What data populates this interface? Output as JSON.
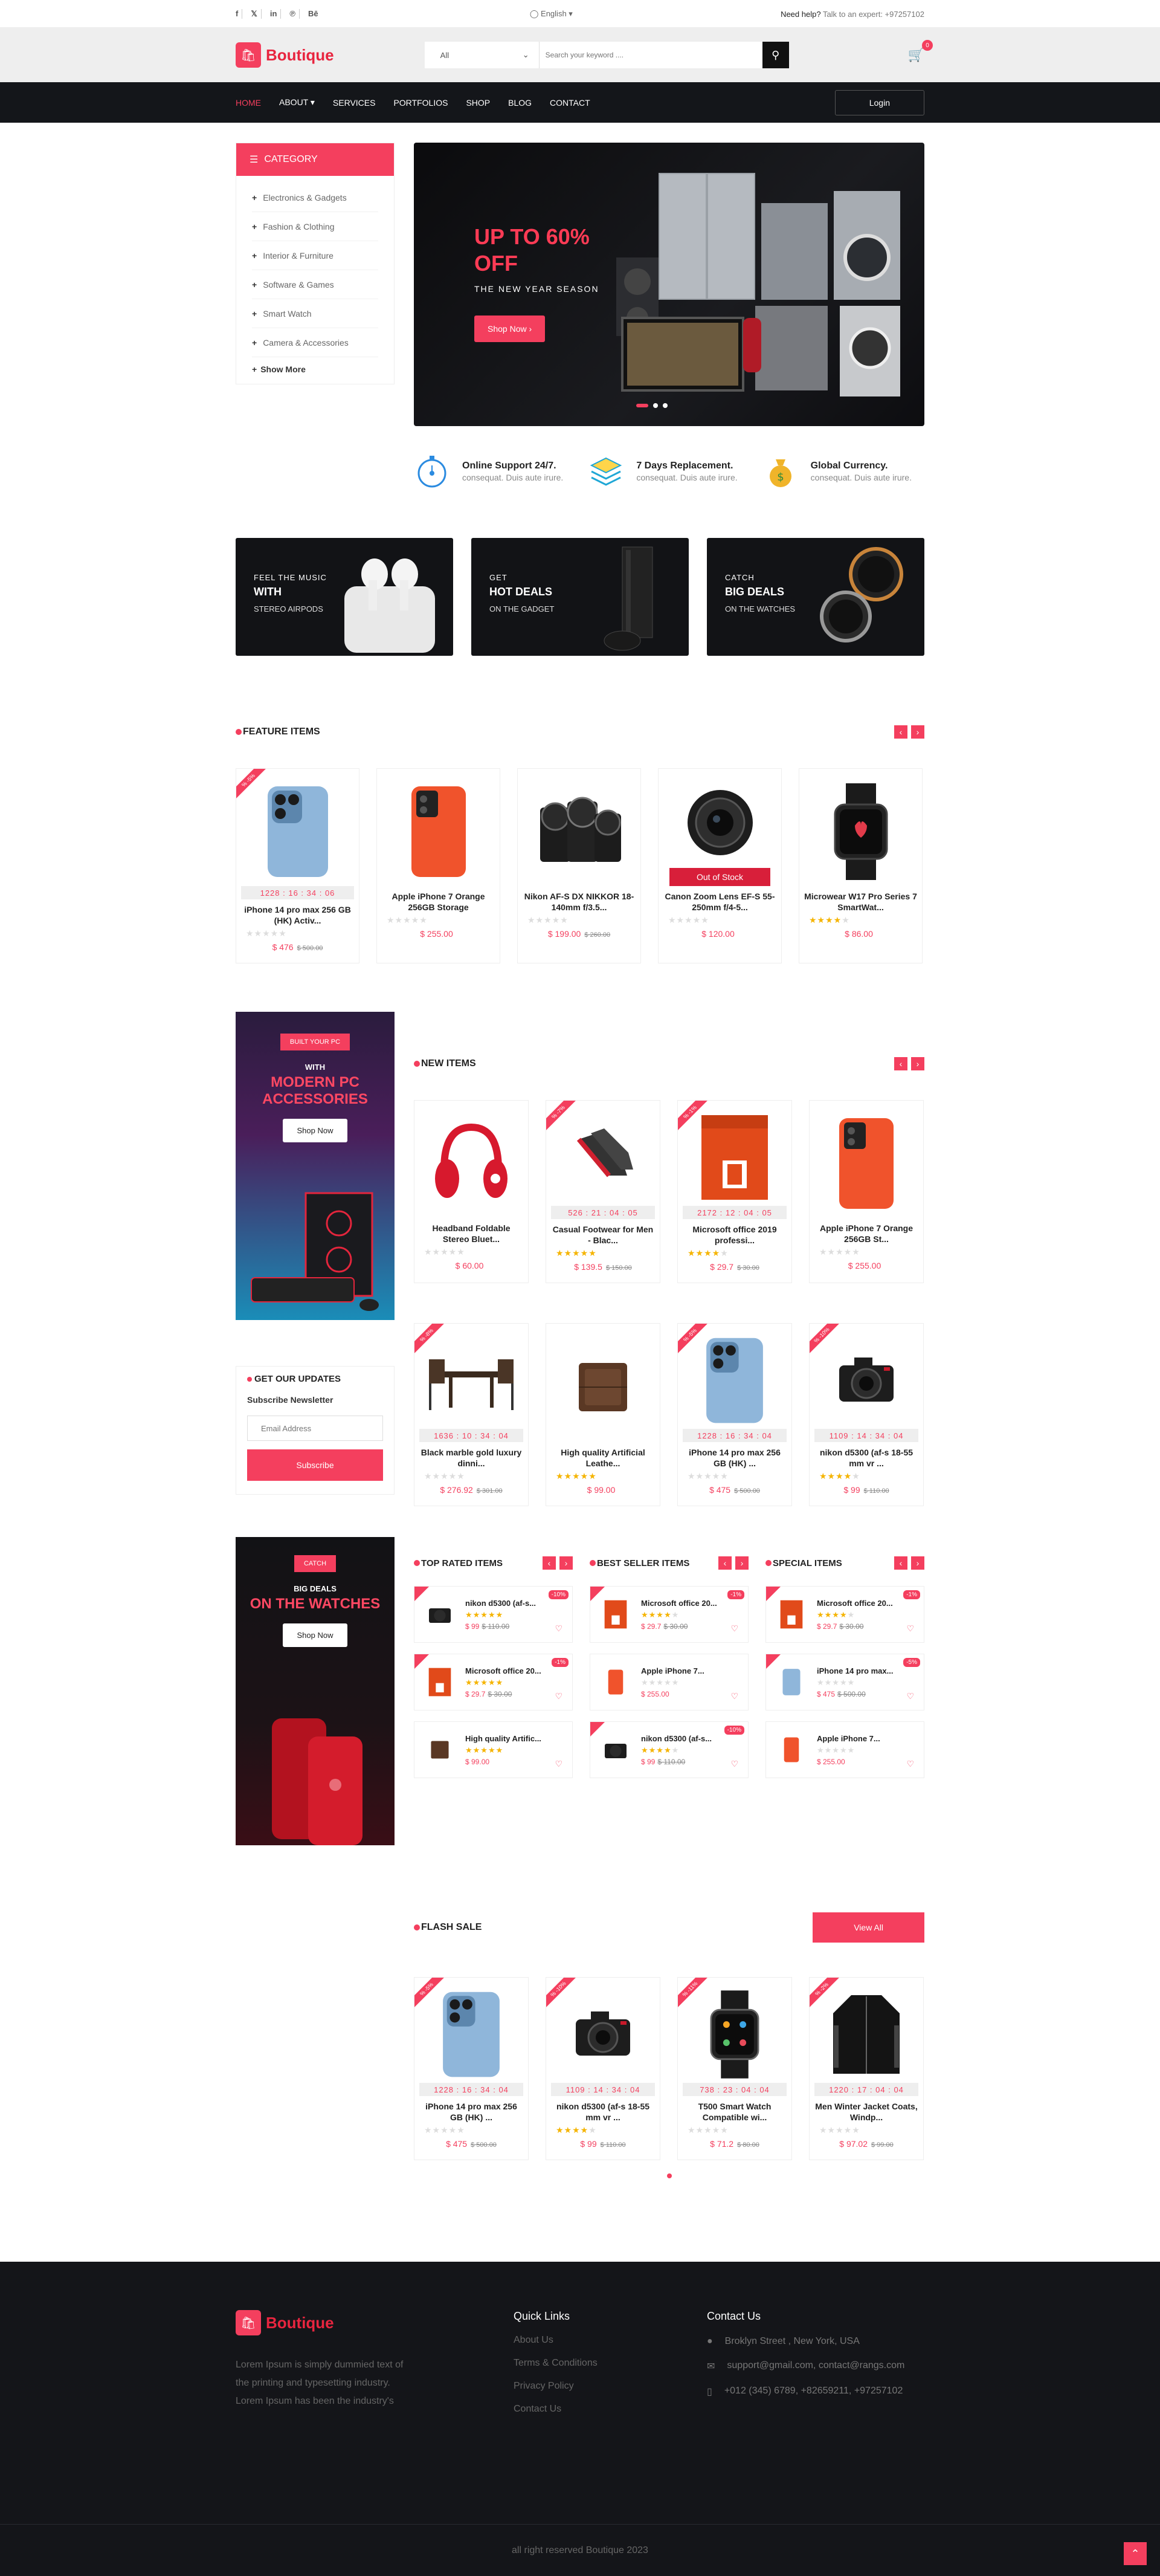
{
  "topbar": {
    "socials": [
      "f",
      "𝕏",
      "in",
      "℗",
      "Bē"
    ],
    "language": "English ▾",
    "help_label": "Need help?",
    "help_text": " Talk to an expert: +97257102"
  },
  "header": {
    "logo_text": "Boutique",
    "search_category": "All",
    "search_placeholder": "Search your keyword ....",
    "cart_count": "0"
  },
  "nav": {
    "items": [
      "Home",
      "About ▾",
      "Services",
      "Portfolios",
      "Shop",
      "Blog",
      "Contact"
    ],
    "login": "Login"
  },
  "categories": {
    "title": "Category",
    "items": [
      "Electronics & Gadgets",
      "Fashion & Clothing",
      "Interior & Furniture",
      "Software & Games",
      "Smart Watch",
      "Camera & Accessories"
    ],
    "more": "Show More"
  },
  "hero": {
    "title": "UP TO 60% OFF",
    "subtitle": "THE NEW YEAR SEASON",
    "button": "Shop Now ›"
  },
  "features": [
    {
      "title": "Online Support 24/7.",
      "desc": "consequat. Duis aute irure."
    },
    {
      "title": "7 Days Replacement.",
      "desc": "consequat. Duis aute irure."
    },
    {
      "title": "Global Currency.",
      "desc": "consequat. Duis aute irure."
    }
  ],
  "banners": [
    {
      "l1": "FEEL THE MUSIC",
      "l2": "WITH",
      "l3": "STEREO AIRPODS"
    },
    {
      "l1": "GET",
      "l2": "HOT DEALS",
      "l3": "ON THE GADGET"
    },
    {
      "l1": "CATCH",
      "l2": "BIG DEALS",
      "l3": "ON THE WATCHES"
    }
  ],
  "feature_items": {
    "title": "Feature Items",
    "products": [
      {
        "name": "iPhone 14 pro max 256 GB (HK) Activ...",
        "price": "$ 476",
        "old": "$ 500.00",
        "timer": "1228 : 16 : 34 : 06",
        "ribbon": "% -5%"
      },
      {
        "name": "Apple iPhone 7 Orange 256GB Storage",
        "price": "$ 255.00",
        "old": ""
      },
      {
        "name": "Nikon AF-S DX NIKKOR 18-140mm f/3.5...",
        "price": "$ 199.00",
        "old": "$ 260.00"
      },
      {
        "name": "Canon Zoom Lens EF-S 55-250mm f/4-5...",
        "price": "$ 120.00",
        "old": "",
        "oos": "Out of Stock"
      },
      {
        "name": "Microwear W17 Pro Series 7 SmartWat...",
        "price": "$ 86.00",
        "old": ""
      }
    ]
  },
  "promo_pc": {
    "tag": "BUILT YOUR PC",
    "small": "WITH",
    "big": "MODERN PC ACCESSORIES",
    "button": "Shop Now"
  },
  "newsletter": {
    "title": "GET OUR UPDATES",
    "subtitle": "Subscribe Newsletter",
    "placeholder": "Email Address",
    "button": "Subscribe"
  },
  "promo_watch": {
    "tag": "CATCH",
    "small": "BIG DEALS",
    "big": "ON THE WATCHES",
    "button": "Shop Now"
  },
  "new_items": {
    "title": "New Items",
    "products": [
      {
        "name": "Headband Foldable Stereo Bluet...",
        "price": "$ 60.00",
        "old": ""
      },
      {
        "name": "Casual Footwear for Men - Blac...",
        "price": "$ 139.5",
        "old": "$ 150.00",
        "timer": "526 : 21 : 04 : 05",
        "ribbon": "% -7%"
      },
      {
        "name": "Microsoft office 2019 professi...",
        "price": "$ 29.7",
        "old": "$ 30.00",
        "timer": "2172 : 12 : 04 : 05",
        "ribbon": "% -1%"
      },
      {
        "name": "Apple iPhone 7 Orange 256GB St...",
        "price": "$ 255.00",
        "old": ""
      },
      {
        "name": "Black marble gold luxury dinni...",
        "price": "$ 276.92",
        "old": "$ 301.00",
        "timer": "1636 : 10 : 34 : 04",
        "ribbon": "% -8%"
      },
      {
        "name": "High quality Artificial Leathe...",
        "price": "$ 99.00",
        "old": ""
      },
      {
        "name": "iPhone 14 pro max 256 GB (HK) ...",
        "price": "$ 475",
        "old": "$ 500.00",
        "timer": "1228 : 16 : 34 : 04",
        "ribbon": "% -5%"
      },
      {
        "name": "nikon d5300 (af-s 18-55 mm vr ...",
        "price": "$ 99",
        "old": "$ 110.00",
        "timer": "1109 : 14 : 34 : 04",
        "ribbon": "% -10%"
      }
    ]
  },
  "top_rated": {
    "title": "Top Rated Items",
    "items": [
      {
        "name": "nikon d5300 (af-s...",
        "price": "$ 99",
        "old": "$ 110.00",
        "badge": "-10%"
      },
      {
        "name": "Microsoft office 20...",
        "price": "$ 29.7",
        "old": "$ 30.00",
        "badge": "-1%"
      },
      {
        "name": "High quality Artific...",
        "price": "$ 99.00",
        "old": "",
        "badge": ""
      }
    ]
  },
  "best_seller": {
    "title": "Best Seller Items",
    "items": [
      {
        "name": "Microsoft office 20...",
        "price": "$ 29.7",
        "old": "$ 30.00",
        "badge": "-1%"
      },
      {
        "name": "Apple iPhone 7...",
        "price": "$ 255.00",
        "old": "",
        "badge": ""
      },
      {
        "name": "nikon d5300 (af-s...",
        "price": "$ 99",
        "old": "$ 110.00",
        "badge": "-10%"
      }
    ]
  },
  "special": {
    "title": "Special Items",
    "items": [
      {
        "name": "Microsoft office 20...",
        "price": "$ 29.7",
        "old": "$ 30.00",
        "badge": "-1%"
      },
      {
        "name": "iPhone 14 pro max...",
        "price": "$ 475",
        "old": "$ 500.00",
        "badge": "-5%"
      },
      {
        "name": "Apple iPhone 7...",
        "price": "$ 255.00",
        "old": "",
        "badge": ""
      }
    ]
  },
  "flash_sale": {
    "title": "Flash Sale",
    "view_all": "View All",
    "products": [
      {
        "name": "iPhone 14 pro max 256 GB (HK) ...",
        "price": "$ 475",
        "old": "$ 500.00",
        "timer": "1228 : 16 : 34 : 04",
        "ribbon": "% -5%"
      },
      {
        "name": "nikon d5300 (af-s 18-55 mm vr ...",
        "price": "$ 99",
        "old": "$ 110.00",
        "timer": "1109 : 14 : 34 : 04",
        "ribbon": "% -10%"
      },
      {
        "name": "T500 Smart Watch Compatible wi...",
        "price": "$ 71.2",
        "old": "$ 80.00",
        "timer": "738 : 23 : 04 : 04",
        "ribbon": "% -11%"
      },
      {
        "name": "Men Winter Jacket Coats, Windp...",
        "price": "$ 97.02",
        "old": "$ 99.00",
        "timer": "1220 : 17 : 04 : 04",
        "ribbon": "% -2%"
      }
    ]
  },
  "footer": {
    "logo_text": "Boutique",
    "desc": "Lorem Ipsum is simply dummied text of the printing and typesetting industry. Lorem Ipsum has been the industry's",
    "quick_title": "Quick Links",
    "links": [
      "About Us",
      "Terms & Conditions",
      "Privacy Policy",
      "Contact Us"
    ],
    "contact_title": "Contact Us",
    "address": "Broklyn Street , New York, USA",
    "email": "support@gmail.com, contact@rangs.com",
    "phone": "+012 (345) 6789, +82659211, +97257102",
    "copyright": "all right reserved Boutique 2023"
  }
}
